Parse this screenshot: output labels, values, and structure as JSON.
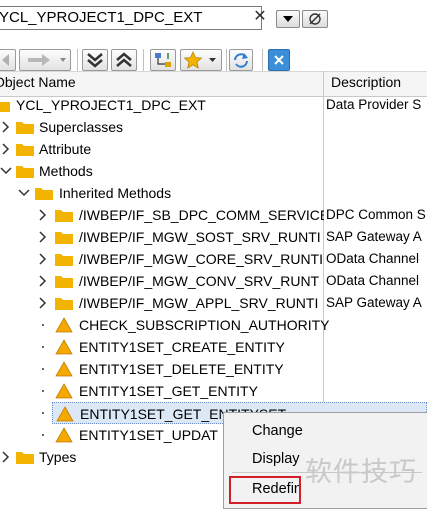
{
  "class_field": {
    "value": "YCL_YPROJECT1_DPC_EXT"
  },
  "table": {
    "col_object_name": "Object Name",
    "col_description": "Description"
  },
  "tree": {
    "root": {
      "label": "YCL_YPROJECT1_DPC_EXT",
      "description": "Data Provider S"
    },
    "superclasses": "Superclasses",
    "attribute": "Attribute",
    "methods": "Methods",
    "inherited_methods": "Inherited Methods",
    "interfaces": [
      {
        "label": "/IWBEP/IF_SB_DPC_COMM_SERVICE",
        "description": "DPC Common S"
      },
      {
        "label": "/IWBEP/IF_MGW_SOST_SRV_RUNTI",
        "description": "SAP Gateway A"
      },
      {
        "label": "/IWBEP/IF_MGW_CORE_SRV_RUNTI",
        "description": "OData Channel"
      },
      {
        "label": "/IWBEP/IF_MGW_CONV_SRV_RUNT",
        "description": "OData Channel"
      },
      {
        "label": "/IWBEP/IF_MGW_APPL_SRV_RUNTI",
        "description": "SAP Gateway A"
      }
    ],
    "methods_list": [
      "CHECK_SUBSCRIPTION_AUTHORITY",
      "ENTITY1SET_CREATE_ENTITY",
      "ENTITY1SET_DELETE_ENTITY",
      "ENTITY1SET_GET_ENTITY",
      "ENTITY1SET_GET_ENTITYSET",
      "ENTITY1SET_UPDAT"
    ],
    "types": "Types"
  },
  "context_menu": {
    "change": "Change",
    "display": "Display",
    "redefine": "Redefin"
  },
  "watermark": "软件技巧",
  "colors": {
    "folder": "#f2b400",
    "warning": "#f5a800",
    "selection": "#dce8f6",
    "highlight_box": "#d21f27"
  },
  "icons": [
    "clear-icon",
    "dropdown-icon",
    "history-icon",
    "back-icon",
    "forward-icon",
    "expand-all-icon",
    "collapse-all-icon",
    "hierarchy-icon",
    "favorites-icon",
    "refresh-icon",
    "close-icon",
    "folder-icon",
    "warning-icon",
    "chevron-right-icon",
    "chevron-down-icon"
  ]
}
